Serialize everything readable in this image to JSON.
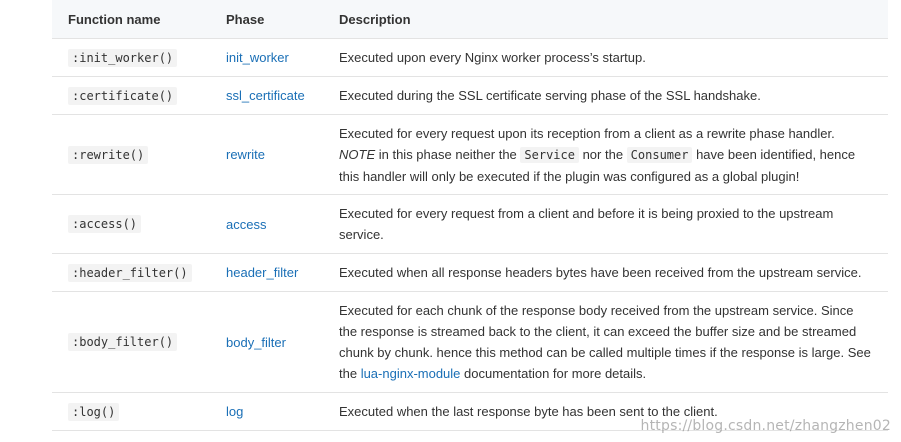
{
  "table": {
    "headers": [
      "Function name",
      "Phase",
      "Description"
    ],
    "rows": [
      {
        "function": ":init_worker()",
        "phase": "init_worker",
        "description": "Executed upon every Nginx worker process’s startup."
      },
      {
        "function": ":certificate()",
        "phase": "ssl_certificate",
        "description": "Executed during the SSL certificate serving phase of the SSL handshake."
      },
      {
        "function": ":rewrite()",
        "phase": "rewrite",
        "description_parts": {
          "p1": "Executed for every request upon its reception from a client as a rewrite phase handler. ",
          "note": "NOTE",
          "p2": " in this phase neither the ",
          "code1": "Service",
          "p3": " nor the ",
          "code2": "Consumer",
          "p4": " have been identified, hence this handler will only be executed if the plugin was configured as a global plugin!"
        }
      },
      {
        "function": ":access()",
        "phase": "access",
        "description": "Executed for every request from a client and before it is being proxied to the upstream service."
      },
      {
        "function": ":header_filter()",
        "phase": "header_filter",
        "description": "Executed when all response headers bytes have been received from the upstream service."
      },
      {
        "function": ":body_filter()",
        "phase": "body_filter",
        "description_parts": {
          "p1": "Executed for each chunk of the response body received from the upstream service. Since the response is streamed back to the client, it can exceed the buffer size and be streamed chunk by chunk. hence this method can be called multiple times if the response is large. See the ",
          "link": "lua-nginx-module",
          "p2": " documentation for more details."
        }
      },
      {
        "function": ":log()",
        "phase": "log",
        "description": "Executed when the last response byte has been sent to the client."
      }
    ]
  },
  "watermark": "https://blog.csdn.net/zhangzhen02",
  "colors": {
    "link": "#1a6fb6",
    "header_bg": "#f6f8fa",
    "border": "#e3e3e3",
    "code_bg": "#f3f3f3"
  }
}
